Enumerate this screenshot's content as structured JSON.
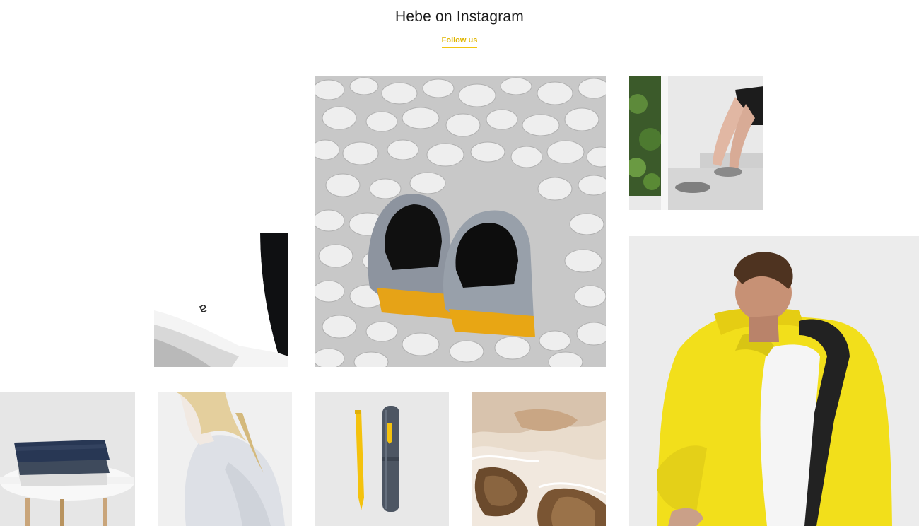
{
  "section": {
    "title": "Hebe on Instagram",
    "follow_label": "Follow us"
  },
  "colors": {
    "accent": "#f2c40f",
    "title_text": "#1b1b1b"
  },
  "gallery": [
    {
      "name": "white-tshirt-logo-photo"
    },
    {
      "name": "wool-shoes-on-pebbles-photo"
    },
    {
      "name": "man-seated-slippers-photo"
    },
    {
      "name": "yellow-jacket-model-photo"
    },
    {
      "name": "folded-shirts-on-stool-photo"
    },
    {
      "name": "woman-grey-top-photo"
    },
    {
      "name": "yellow-pen-and-case-photo"
    },
    {
      "name": "salt-flat-texture-photo"
    }
  ]
}
